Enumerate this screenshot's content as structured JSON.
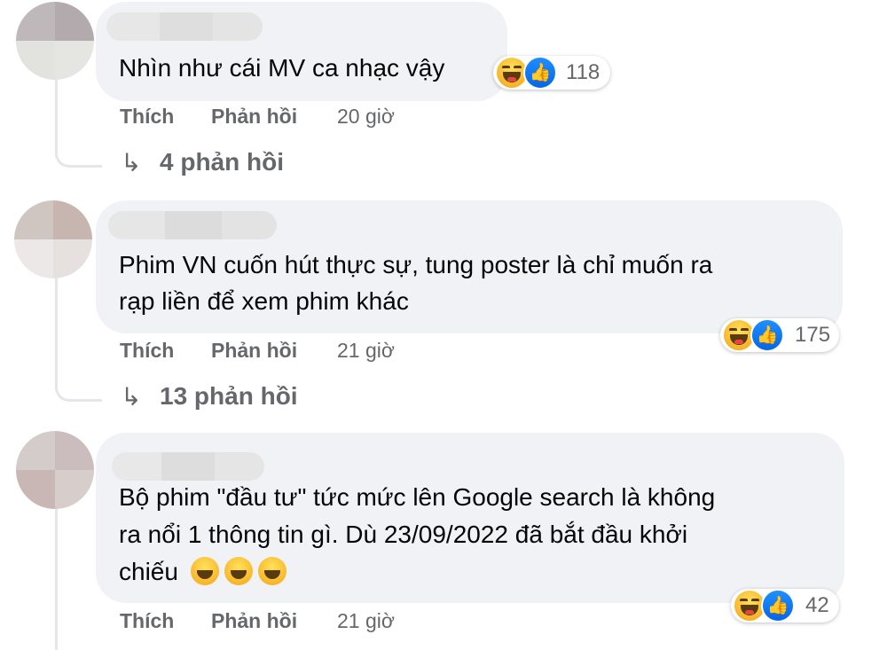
{
  "comments": [
    {
      "text": "Nhìn như cái MV ca nhạc vậy",
      "reaction_icons": [
        "haha-icon",
        "like-icon"
      ],
      "reaction_count": "118",
      "like_label": "Thích",
      "reply_label": "Phản hồi",
      "time": "20 giờ",
      "replies_text": "4 phản hồi"
    },
    {
      "text_lines": [
        "Phim VN cuốn hút thực sự, tung poster là chỉ muốn ra",
        "rạp liền để xem phim khác"
      ],
      "reaction_icons": [
        "haha-icon",
        "like-icon"
      ],
      "reaction_count": "175",
      "like_label": "Thích",
      "reply_label": "Phản hồi",
      "time": "21 giờ",
      "replies_text": "13 phản hồi"
    },
    {
      "text_lines": [
        "Bộ phim \"đầu tư\" tức mức lên Google search là không",
        "ra nổi 1 thông tin gì. Dù 23/09/2022 đã bắt đầu khởi",
        "chiếu"
      ],
      "inline_emojis": [
        "rolling-laugh-icon",
        "joy-icon",
        "sweat-smile-icon"
      ],
      "reaction_icons": [
        "haha-icon",
        "like-icon"
      ],
      "reaction_count": "42",
      "like_label": "Thích",
      "reply_label": "Phản hồi",
      "time": "21 giờ"
    }
  ],
  "colors": {
    "bubble": "#f0f2f5",
    "secondary_text": "#65676b",
    "like_blue": "#0566e6",
    "haha_yellow": "#f7b125"
  }
}
